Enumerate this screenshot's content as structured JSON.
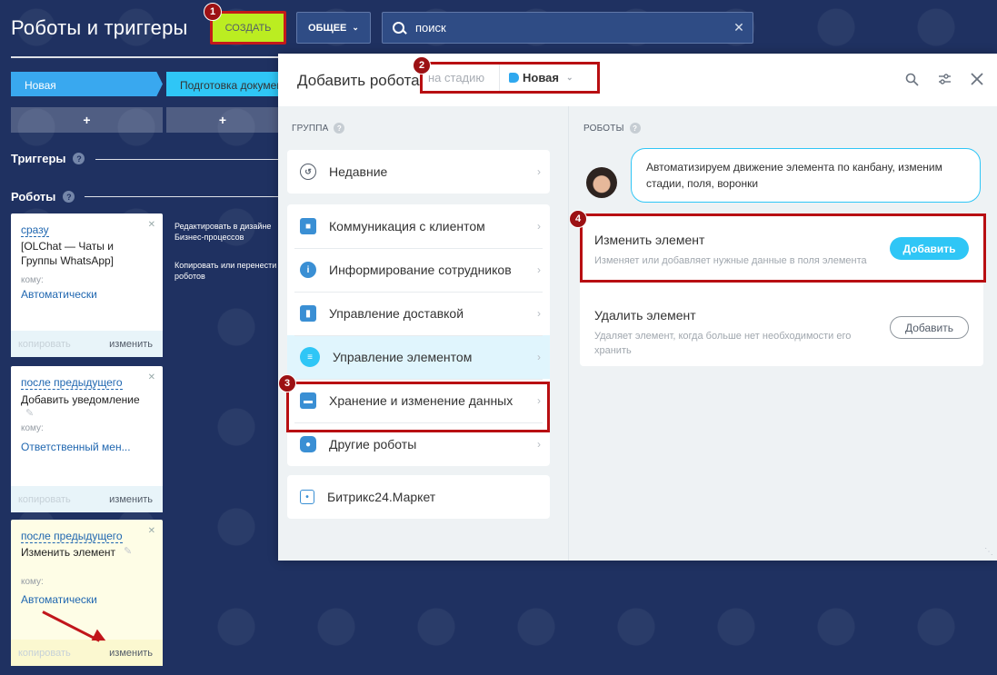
{
  "page": {
    "title": "Роботы и триггеры"
  },
  "toolbar": {
    "create_label": "СОЗДАТЬ",
    "general_label": "ОБЩЕЕ",
    "search_value": "поиск",
    "search_clear_icon": "close-icon",
    "search_icon": "search-icon"
  },
  "stages": [
    "Новая",
    "Подготовка документов"
  ],
  "add_label": "+",
  "sections": {
    "triggers": "Триггеры",
    "robots": "Роботы"
  },
  "cards": [
    {
      "when": "сразу",
      "name": "[OLChat — Чаты и Группы WhatsApp]",
      "whom_label": "кому:",
      "whom_value": "Автоматически",
      "copy": "копировать",
      "edit": "изменить"
    },
    {
      "when": "после предыдущего",
      "name": "Добавить уведомление",
      "whom_label": "кому:",
      "whom_value": "Ответственный мен...",
      "copy": "копировать",
      "edit": "изменить"
    },
    {
      "when": "после предыдущего",
      "name": "Изменить элемент",
      "whom_label": "кому:",
      "whom_value": "Автоматически",
      "copy": "копировать",
      "edit": "изменить"
    }
  ],
  "side_notes": [
    "Редактировать в дизайне Бизнес-процессов",
    "Копировать или перенести роботов"
  ],
  "badges": [
    "1",
    "2",
    "3",
    "4"
  ],
  "slider": {
    "title": "Добавить робота",
    "stage_label": "на стадию",
    "stage_value": "Новая",
    "group_label": "ГРУППА",
    "robots_label": "РОБОТЫ",
    "groups_top": [
      {
        "label": "Недавние",
        "icon": "history-icon"
      }
    ],
    "groups_main": [
      {
        "label": "Коммуникация с клиентом",
        "icon": "chat-icon"
      },
      {
        "label": "Информирование сотрудников",
        "icon": "info-icon"
      },
      {
        "label": "Управление доставкой",
        "icon": "truck-icon"
      },
      {
        "label": "Управление элементом",
        "icon": "filter-icon"
      },
      {
        "label": "Хранение и изменение данных",
        "icon": "database-icon"
      },
      {
        "label": "Другие роботы",
        "icon": "robot-icon"
      }
    ],
    "groups_market": [
      {
        "label": "Битрикс24.Маркет",
        "icon": "market-icon"
      }
    ],
    "bubble_text": "Автоматизируем движение элемента по канбану, изменим стадии, поля, воронки",
    "robots": [
      {
        "title": "Изменить элемент",
        "desc": "Изменяет или добавляет нужные данные в поля элемента",
        "button": "Добавить"
      },
      {
        "title": "Удалить элемент",
        "desc": "Удаляет элемент, когда больше нет необходимости его хранить",
        "button": "Добавить"
      }
    ]
  },
  "colors": {
    "background": "#1f3161",
    "create_button": "#bbed21",
    "highlight": "#b80f12",
    "accent": "#2fc6f6"
  }
}
